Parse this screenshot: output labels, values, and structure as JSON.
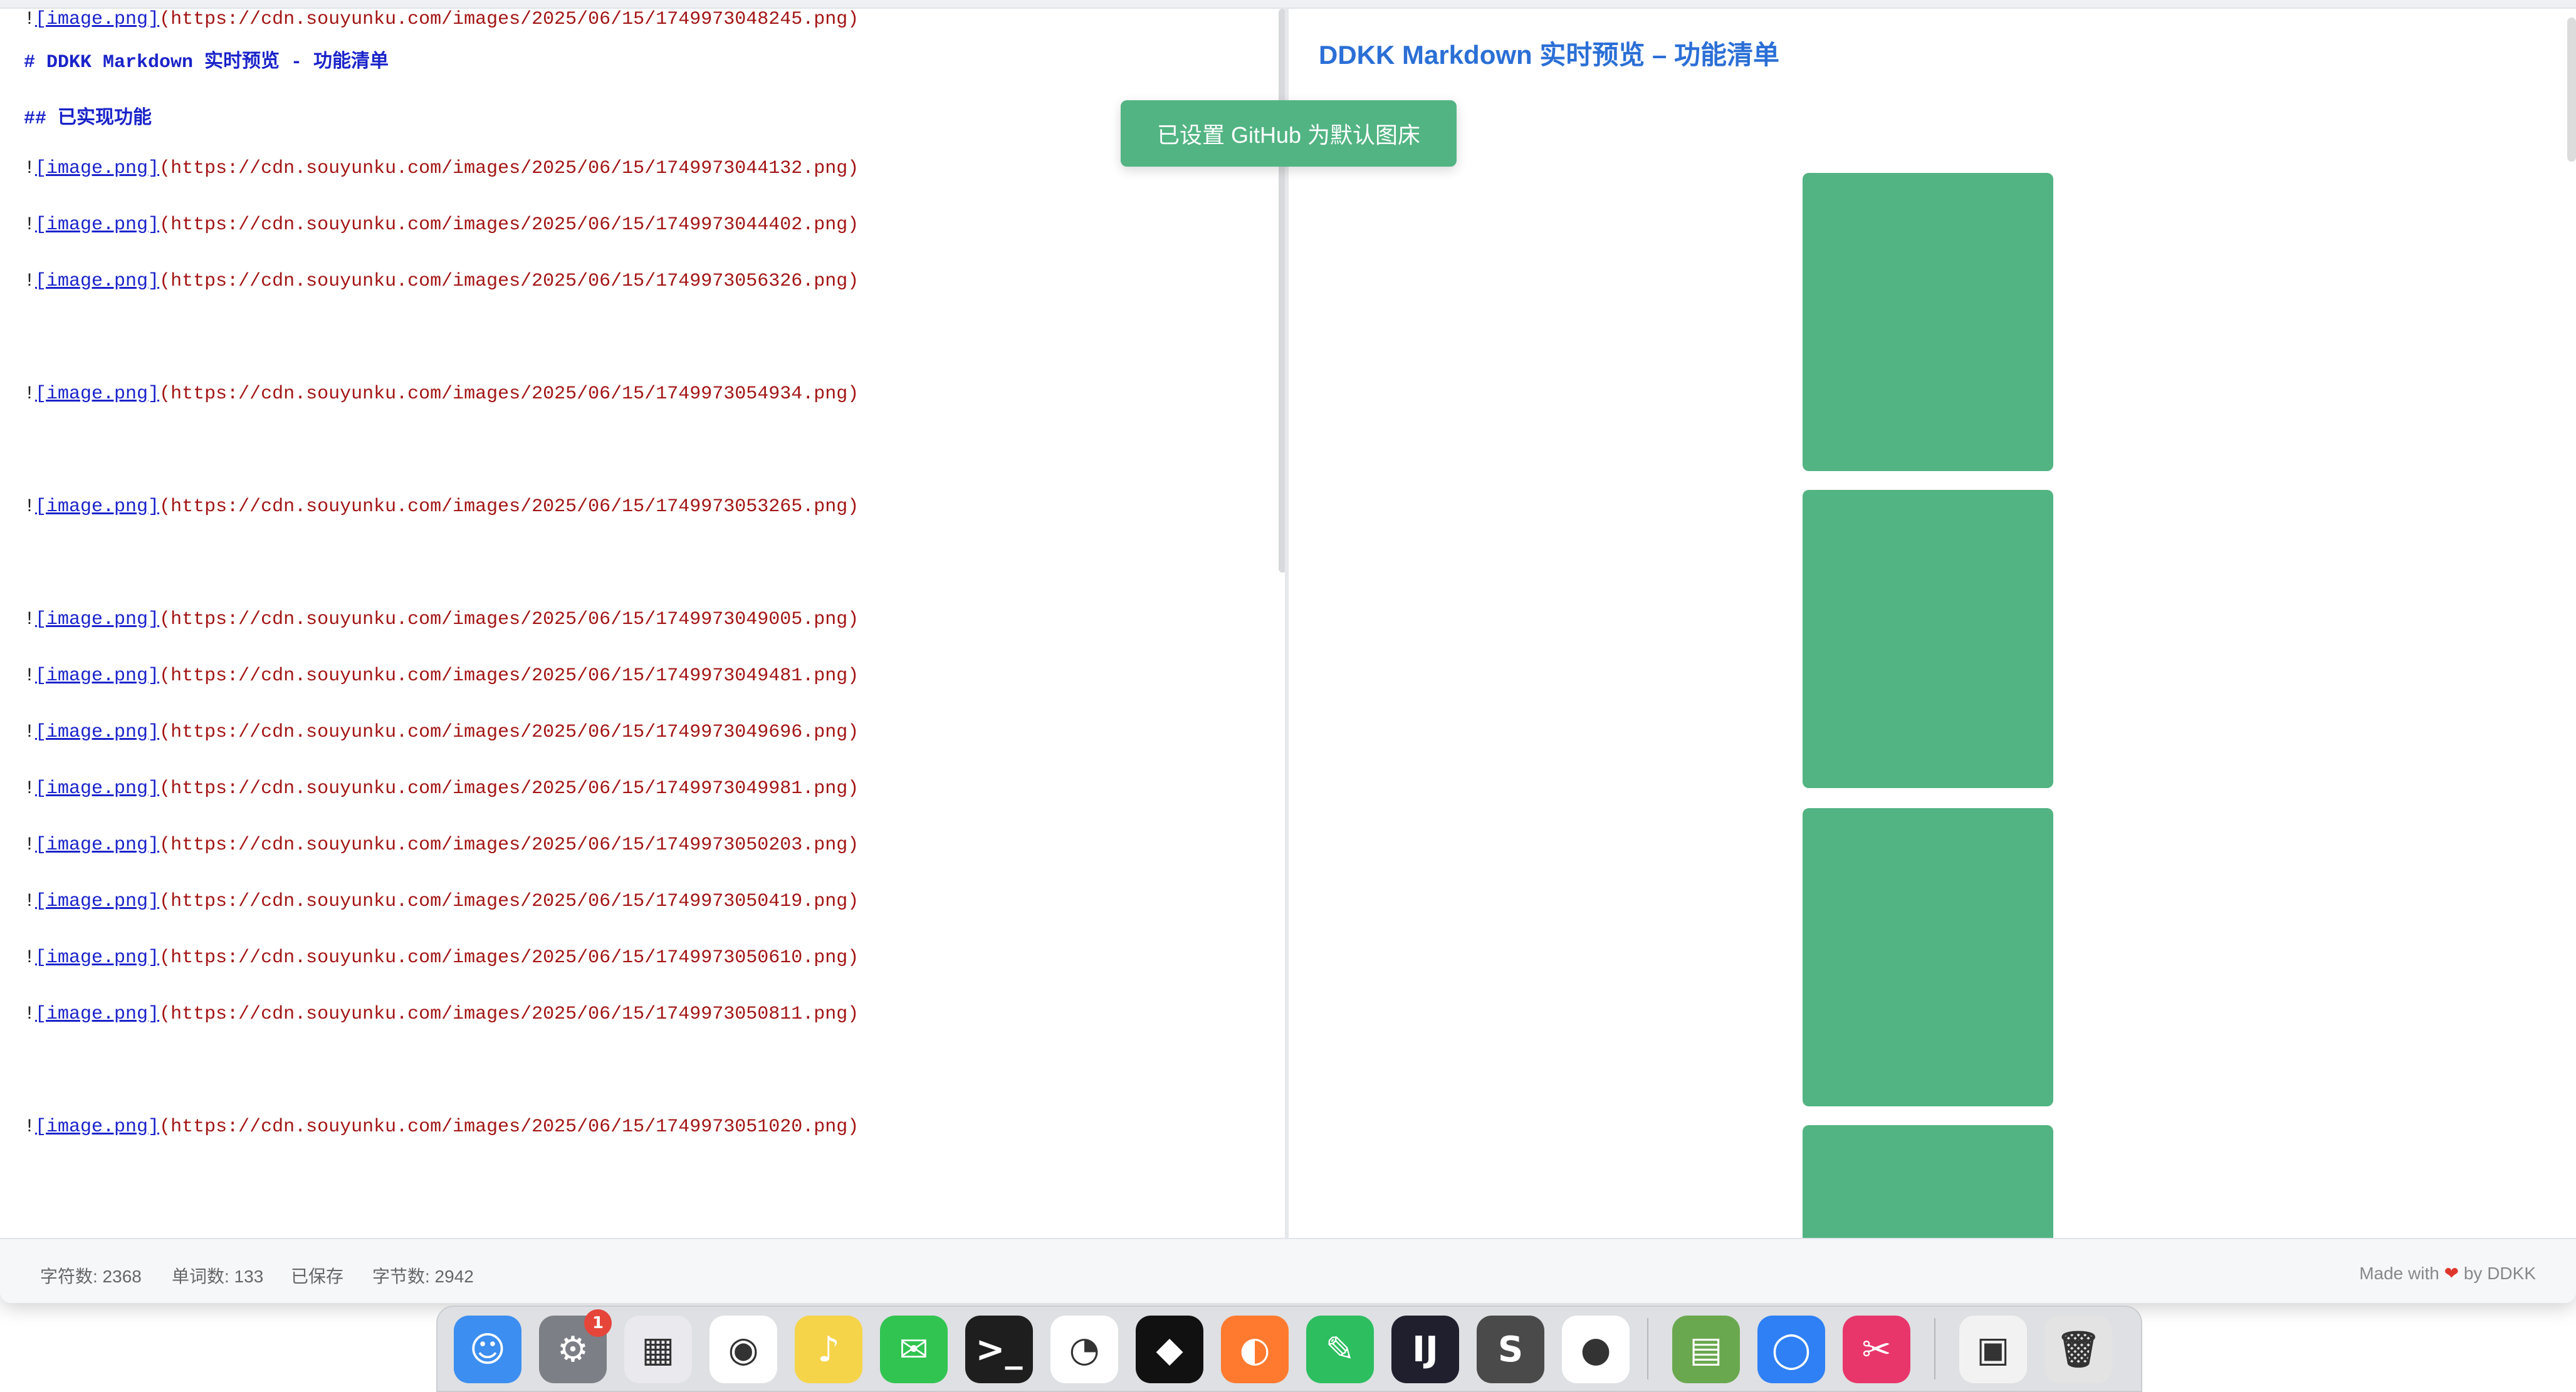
{
  "editor": {
    "lines": [
      {
        "kind": "heading",
        "text": "# DDKK Markdown 实时预览 - 功能清单"
      },
      {
        "kind": "heading",
        "text": "## 已实现功能"
      },
      {
        "kind": "img",
        "bang": "!",
        "link": "[image.png]",
        "url": "(https://cdn.souyunku.com/images/2025/06/15/1749973044132.png)"
      },
      {
        "kind": "img",
        "bang": "!",
        "link": "[image.png]",
        "url": "(https://cdn.souyunku.com/images/2025/06/15/1749973044402.png)"
      },
      {
        "kind": "img",
        "bang": "!",
        "link": "[image.png]",
        "url": "(https://cdn.souyunku.com/images/2025/06/15/1749973056326.png)"
      },
      {
        "kind": "img",
        "bang": "!",
        "link": "[image.png]",
        "url": "(https://cdn.souyunku.com/images/2025/06/15/1749973054934.png)"
      },
      {
        "kind": "img",
        "bang": "!",
        "link": "[image.png]",
        "url": "(https://cdn.souyunku.com/images/2025/06/15/1749973053265.png)"
      },
      {
        "kind": "img",
        "bang": "!",
        "link": "[image.png]",
        "url": "(https://cdn.souyunku.com/images/2025/06/15/1749973049005.png)"
      },
      {
        "kind": "img",
        "bang": "!",
        "link": "[image.png]",
        "url": "(https://cdn.souyunku.com/images/2025/06/15/1749973049481.png)"
      },
      {
        "kind": "img",
        "bang": "!",
        "link": "[image.png]",
        "url": "(https://cdn.souyunku.com/images/2025/06/15/1749973049696.png)"
      },
      {
        "kind": "img",
        "bang": "!",
        "link": "[image.png]",
        "url": "(https://cdn.souyunku.com/images/2025/06/15/1749973049981.png)"
      },
      {
        "kind": "img",
        "bang": "!",
        "link": "[image.png]",
        "url": "(https://cdn.souyunku.com/images/2025/06/15/1749973050203.png)"
      },
      {
        "kind": "img",
        "bang": "!",
        "link": "[image.png]",
        "url": "(https://cdn.souyunku.com/images/2025/06/15/1749973050419.png)"
      },
      {
        "kind": "img",
        "bang": "!",
        "link": "[image.png]",
        "url": "(https://cdn.souyunku.com/images/2025/06/15/1749973050610.png)"
      },
      {
        "kind": "img",
        "bang": "!",
        "link": "[image.png]",
        "url": "(https://cdn.souyunku.com/images/2025/06/15/1749973050811.png)"
      },
      {
        "kind": "img",
        "bang": "!",
        "link": "[image.png]",
        "url": "(https://cdn.souyunku.com/images/2025/06/15/1749973051020.png)"
      },
      {
        "kind": "img",
        "bang": "!",
        "link": "[image.png]",
        "url": "(https://cdn.souyunku.com/images/2025/06/15/1749973048245.png)"
      }
    ]
  },
  "preview": {
    "title": "DDKK Markdown 实时预览 – 功能清单",
    "image_color": "#52b483"
  },
  "toast": {
    "text": "已设置 GitHub 为默认图床"
  },
  "status": {
    "chars": "字符数: 2368",
    "words": "单词数: 133",
    "saved": "已保存",
    "bytes": "字节数: 2942",
    "made_prefix": "Made with",
    "heart": "❤",
    "made_suffix": "by DDKK"
  },
  "dock": {
    "badge": "1",
    "apps": [
      {
        "name": "finder-icon",
        "glyph": "☺",
        "color": "#3c8ef0"
      },
      {
        "name": "system-settings-icon",
        "glyph": "⚙",
        "color": "#7c7f85"
      },
      {
        "name": "launchpad-icon",
        "glyph": "▦",
        "color": "#e9e9ee"
      },
      {
        "name": "chrome-icon",
        "glyph": "◉",
        "color": "#ffffff"
      },
      {
        "name": "qq-music-icon",
        "glyph": "♪",
        "color": "#f6d44a"
      },
      {
        "name": "wechat-icon",
        "glyph": "✉",
        "color": "#31c451"
      },
      {
        "name": "terminal-icon",
        "glyph": ">_",
        "color": "#1e1e1e"
      },
      {
        "name": "screen-recorder-icon",
        "glyph": "◔",
        "color": "#ffffff"
      },
      {
        "name": "cube-app-icon",
        "glyph": "◆",
        "color": "#111111"
      },
      {
        "name": "firefox-icon",
        "glyph": "◐",
        "color": "#ff7a2f"
      },
      {
        "name": "evernote-icon",
        "glyph": "✎",
        "color": "#2dbe60"
      },
      {
        "name": "intellij-icon",
        "glyph": "IJ",
        "color": "#1f1f2e"
      },
      {
        "name": "sublime-text-icon",
        "glyph": "S",
        "color": "#4a4a4a"
      },
      {
        "name": "qq-icon",
        "glyph": "●",
        "color": "#ffffff"
      },
      {
        "name": "rar-archiver-icon",
        "glyph": "▤",
        "color": "#6aa84f"
      },
      {
        "name": "signal-icon",
        "glyph": "◯",
        "color": "#2f7ff5"
      },
      {
        "name": "kuaitie-icon",
        "glyph": "✂",
        "color": "#e8366b"
      },
      {
        "name": "downloads-stack-icon",
        "glyph": "▣",
        "color": "#f2f2f2"
      },
      {
        "name": "trash-icon",
        "glyph": "🗑",
        "color": "#e3e3e3"
      }
    ]
  }
}
